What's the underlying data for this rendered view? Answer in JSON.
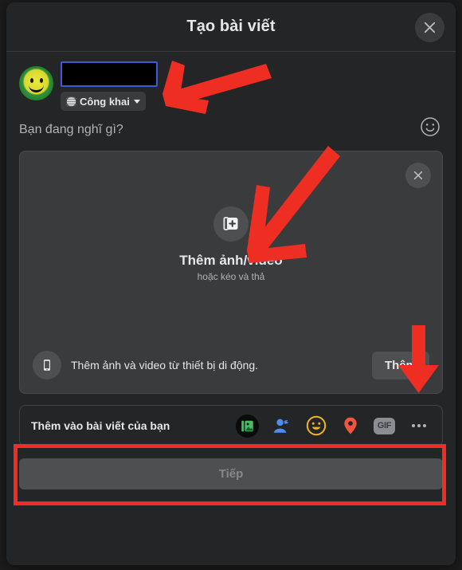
{
  "window": {
    "title": "Tạo bài viết",
    "close_icon": "close-icon"
  },
  "author": {
    "avatar_icon": "smiley-avatar",
    "name_value": "",
    "privacy": {
      "label": "Công khai",
      "icon": "globe-icon",
      "caret_icon": "chevron-down-icon"
    }
  },
  "composer": {
    "placeholder": "Bạn đang nghĩ gì?",
    "emoji_icon": "emoji-smiley-icon"
  },
  "media": {
    "dropzone": {
      "icon": "add-photo-icon",
      "title": "Thêm ảnh/video",
      "subtitle": "hoặc kéo và thả",
      "close_icon": "close-icon"
    },
    "mobile": {
      "icon": "mobile-phone-icon",
      "text": "Thêm ảnh và video từ thiết bị di động.",
      "button_label": "Thêm"
    }
  },
  "add_to_post": {
    "label": "Thêm vào bài viết của bạn",
    "items": [
      {
        "name": "photo-video-icon",
        "color": "#45bd62"
      },
      {
        "name": "tag-people-icon",
        "color": "#1877f2"
      },
      {
        "name": "feeling-activity-icon",
        "color": "#f7b928"
      },
      {
        "name": "location-icon",
        "color": "#f5533d"
      },
      {
        "name": "gif-icon",
        "color": "#8a8d91",
        "text": "GIF"
      },
      {
        "name": "more-options-icon",
        "color": "#b0b3b8"
      }
    ]
  },
  "footer": {
    "next_label": "Tiếp"
  },
  "annotations": {
    "arrow_color": "#ee2d23",
    "highlight_color": "#ee2d23",
    "arrows": [
      {
        "name": "arrow-to-privacy-selector",
        "direction": "left"
      },
      {
        "name": "arrow-to-add-photo-icon",
        "direction": "down-left"
      },
      {
        "name": "arrow-to-add-button",
        "direction": "down"
      }
    ],
    "boxes": [
      {
        "name": "highlight-add-to-post-row"
      }
    ]
  }
}
